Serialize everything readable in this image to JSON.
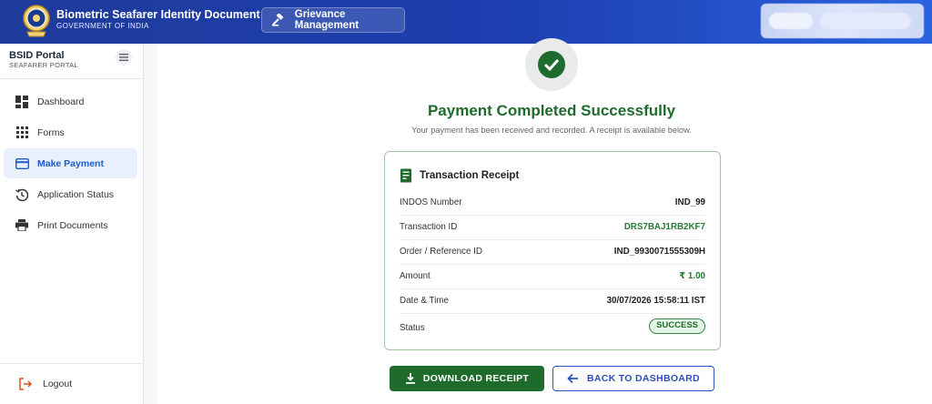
{
  "header": {
    "title": "Biometric Seafarer Identity Document",
    "subtitle": "GOVERNMENT OF INDIA",
    "grievance_label": "Grievance Management"
  },
  "sidebar": {
    "brand_name": "BSID Portal",
    "brand_sub": "SEAFARER PORTAL",
    "items": [
      {
        "label": "Dashboard",
        "icon": "dashboard-icon",
        "active": false
      },
      {
        "label": "Forms",
        "icon": "grid-icon",
        "active": false
      },
      {
        "label": "Make Payment",
        "icon": "credit-card-icon",
        "active": true
      },
      {
        "label": "Application Status",
        "icon": "history-icon",
        "active": false
      },
      {
        "label": "Print Documents",
        "icon": "printer-icon",
        "active": false
      }
    ],
    "logout_label": "Logout"
  },
  "main": {
    "title": "Payment Completed Successfully",
    "subtitle": "Your payment has been received and recorded. A receipt is available below.",
    "receipt": {
      "heading": "Transaction Receipt",
      "rows": [
        {
          "label": "INDOS Number",
          "value": "IND_99"
        },
        {
          "label": "Transaction ID",
          "value": "DRS7BAJ1RB2KF7"
        },
        {
          "label": "Order / Reference ID",
          "value": "IND_9930071555309H"
        },
        {
          "label": "Amount",
          "value": "₹ 1.00"
        },
        {
          "label": "Date & Time",
          "value": "30/07/2026 15:58:11 IST"
        },
        {
          "label": "Status",
          "value": "SUCCESS"
        }
      ]
    },
    "download_label": "DOWNLOAD RECEIPT",
    "back_label": "BACK TO DASHBOARD"
  },
  "colors": {
    "header": "#1e3a9a",
    "success_green": "#1f6b2c",
    "accent_blue": "#1d5bd1"
  }
}
